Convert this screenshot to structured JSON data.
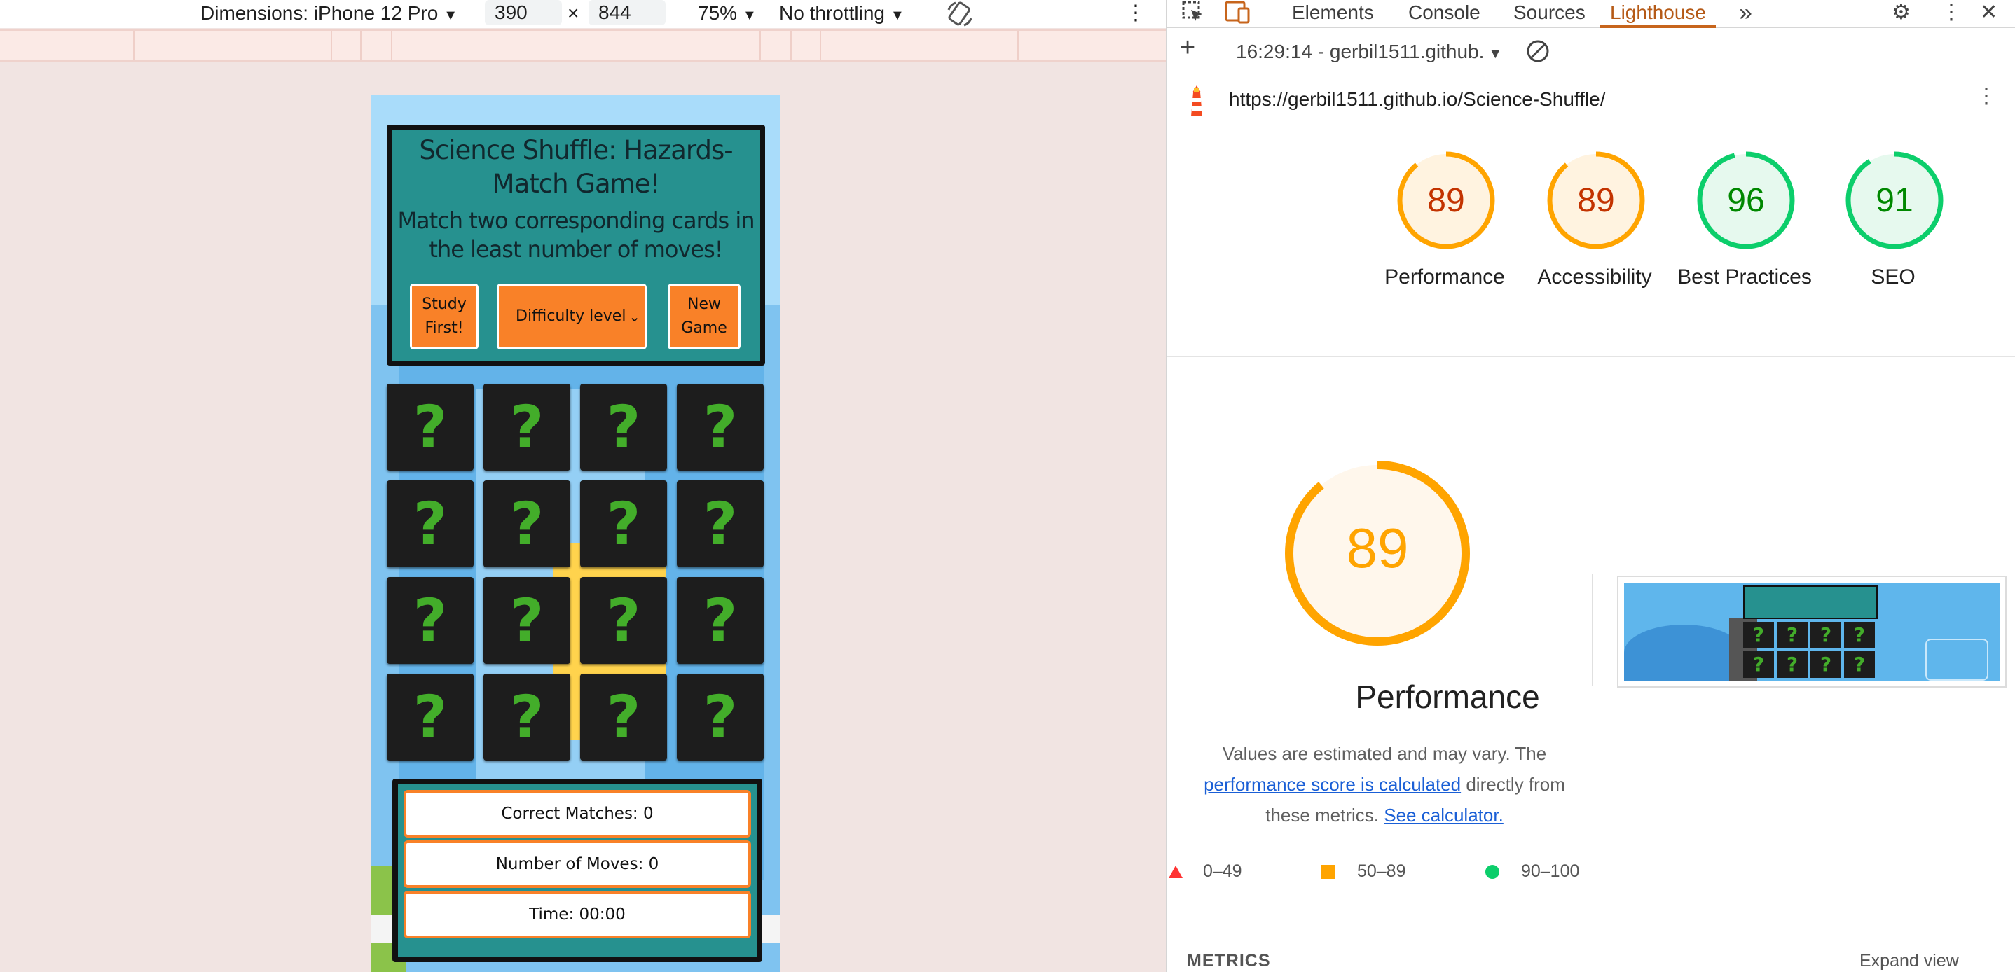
{
  "device_toolbar": {
    "dimensions_label": "Dimensions: iPhone 12 Pro",
    "width_value": "390",
    "times": "×",
    "height_value": "844",
    "zoom": "75%",
    "throttling": "No throttling",
    "caret": "▼"
  },
  "game": {
    "title": "Science Shuffle: Hazards-Match Game!",
    "subtitle": "Match two corresponding cards in the least number of moves!",
    "study_button": "Study First!",
    "difficulty_select": "Difficulty level",
    "new_game_button": "New Game",
    "card_symbol": "?",
    "stats": {
      "matches": "Correct Matches:  0",
      "moves": "Number of Moves:  0",
      "time": "Time:  00:00"
    }
  },
  "devtools": {
    "tabs": [
      "Elements",
      "Console",
      "Sources",
      "Lighthouse"
    ],
    "active_tab": "Lighthouse",
    "more_tabs": "»",
    "report_label": "16:29:14 - gerbil1511.github.",
    "url": "https://gerbil1511.github.io/Science-Shuffle/"
  },
  "lighthouse": {
    "scores": [
      {
        "label": "Performance",
        "value": 89,
        "color": "#c33300",
        "stroke": "#ffa400",
        "fill": "#fff3e0"
      },
      {
        "label": "Accessibility",
        "value": 89,
        "color": "#c33300",
        "stroke": "#ffa400",
        "fill": "#fff3e0"
      },
      {
        "label": "Best Practices",
        "value": 96,
        "color": "#008800",
        "stroke": "#0cce6b",
        "fill": "#e6f9ee"
      },
      {
        "label": "SEO",
        "value": 91,
        "color": "#008800",
        "stroke": "#0cce6b",
        "fill": "#e6f9ee"
      }
    ],
    "labels": {
      "perf": "Performance",
      "acc": "Accessibility",
      "bp": "Best Practices",
      "seo": "SEO"
    },
    "values": {
      "perf": "89",
      "acc": "89",
      "bp": "96",
      "seo": "91"
    },
    "big_score": "89",
    "big_score_value": 89,
    "perf_title": "Performance",
    "desc_1": "Values are estimated and may vary. The",
    "desc_link_1": "performance score is calculated",
    "desc_2": " directly from these metrics.",
    "desc_link_2": "See calculator.",
    "legend": {
      "fail": "0–49",
      "average": "50–89",
      "pass": "90–100"
    },
    "metrics_heading": "METRICS",
    "expand_view": "Expand view"
  },
  "colors": {
    "orange": "#ffa400",
    "green": "#0cce6b",
    "red": "#ff3333",
    "teal": "#26918f",
    "card_q": "#43ad2a"
  }
}
